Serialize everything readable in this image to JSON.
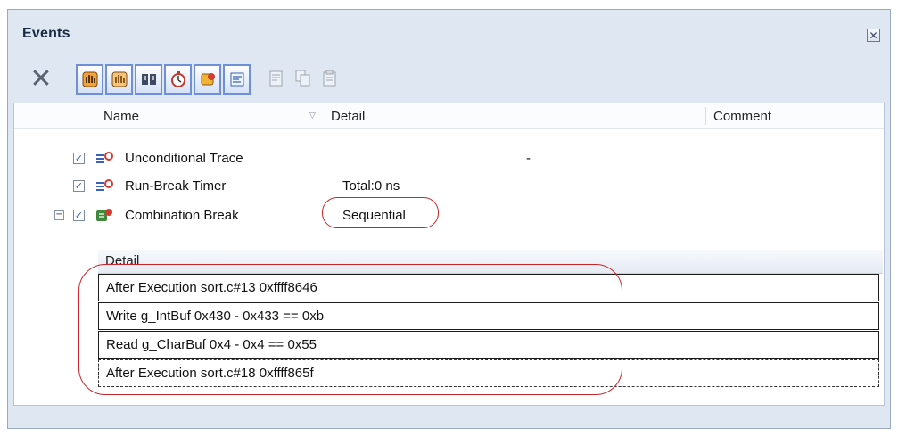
{
  "window": {
    "title": "Events",
    "close_icon": "close-icon"
  },
  "toolbar": {
    "buttons": [
      {
        "icon": "delete-icon",
        "enabled": true
      },
      {
        "icon": "hardware-break-hand-icon",
        "enabled": true,
        "pressed": true
      },
      {
        "icon": "software-break-hand-icon",
        "enabled": true,
        "pressed": true
      },
      {
        "icon": "trace-event-icon",
        "enabled": true,
        "pressed": true
      },
      {
        "icon": "timer-stopwatch-icon",
        "enabled": true,
        "pressed": true
      },
      {
        "icon": "combination-break-icon",
        "enabled": true,
        "pressed": true
      },
      {
        "icon": "action-event-icon",
        "enabled": true,
        "pressed": true
      },
      {
        "icon": "edit-condition-icon",
        "enabled": false
      },
      {
        "icon": "copy-event-icon",
        "enabled": false
      },
      {
        "icon": "paste-event-icon",
        "enabled": false
      }
    ]
  },
  "columns": {
    "name": "Name",
    "detail": "Detail",
    "comment": "Comment"
  },
  "events": [
    {
      "name": "Unconditional Trace",
      "detail": "-",
      "checked": true,
      "icon": "trace-event-icon"
    },
    {
      "name": "Run-Break Timer",
      "detail": "Total:0 ns",
      "checked": true,
      "icon": "timer-event-icon"
    },
    {
      "name": "Combination Break",
      "detail": "Sequential",
      "checked": true,
      "expanded": true,
      "icon": "combination-break-icon"
    }
  ],
  "subgrid": {
    "header": "Detail",
    "rows": [
      "After Execution sort.c#13 0xffff8646",
      "Write g_IntBuf 0x430 - 0x433 == 0xb",
      "Read g_CharBuf 0x4 - 0x4 == 0x55",
      "After Execution sort.c#18 0xffff865f"
    ]
  },
  "colors": {
    "accent": "#6f8fd6",
    "callout": "#c8262b",
    "panel_bg": "#dfe7f3"
  }
}
